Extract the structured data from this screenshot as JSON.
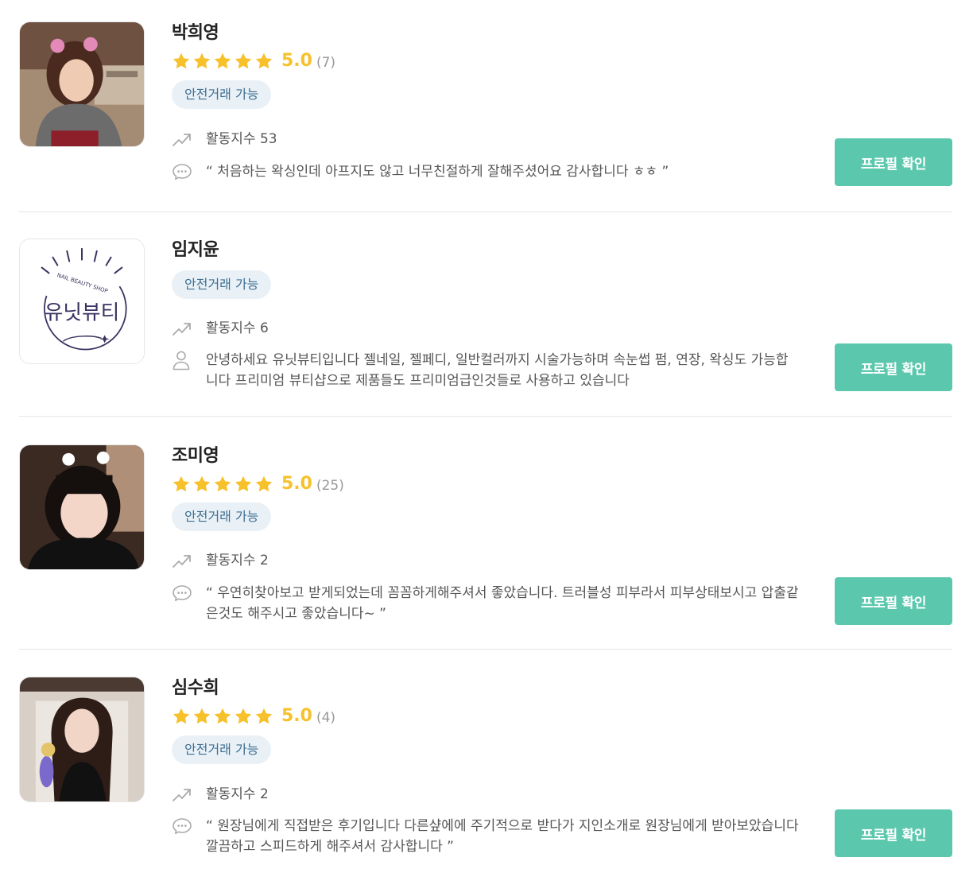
{
  "labels": {
    "safe_trade": "안전거래 가능",
    "profile_button": "프로필 확인"
  },
  "colors": {
    "accent": "#5bc8ae",
    "star": "#f7c12c",
    "badge_bg": "#e9f1f7",
    "badge_text": "#3d6e91"
  },
  "experts": [
    {
      "name": "박희영",
      "rating": {
        "score": "5.0",
        "count": "(7)",
        "stars": 5
      },
      "activity": "활동지수 53",
      "review_type": "chat-bubble-icon",
      "review": "“ 처음하는 왁싱인데 아프지도 않고 너무친절하게 잘해주셨어요 감사합니다 ㅎㅎ ”"
    },
    {
      "name": "임지윤",
      "activity": "활동지수 6",
      "review_type": "user-icon",
      "review": "안녕하세요 유닛뷰티입니다 젤네일, 젤페디, 일반컬러까지 시술가능하며 속눈썹 펌, 연장, 왁싱도 가능합니다 프리미엄 뷰티샵으로 제품들도 프리미엄급인것들로 사용하고 있습니다",
      "logo": {
        "title": "유닛뷰티",
        "subtitle": "NAIL BEAUTY SHOP"
      }
    },
    {
      "name": "조미영",
      "rating": {
        "score": "5.0",
        "count": "(25)",
        "stars": 5
      },
      "activity": "활동지수 2",
      "review_type": "chat-bubble-icon",
      "review": "“ 우연히찾아보고 받게되었는데 꼼꼼하게해주셔서 좋았습니다. 트러블성 피부라서 피부상태보시고 압출같은것도 해주시고 좋았습니다~ ”"
    },
    {
      "name": "심수희",
      "rating": {
        "score": "5.0",
        "count": "(4)",
        "stars": 5
      },
      "activity": "활동지수 2",
      "review_type": "chat-bubble-icon",
      "review": "“ 원장님에게 직접받은 후기입니다 다른샾에에 주기적으로 받다가 지인소개로 원장님에게 받아보았습니다 깔끔하고 스피드하게 해주셔서 감사합니다 ”"
    }
  ]
}
